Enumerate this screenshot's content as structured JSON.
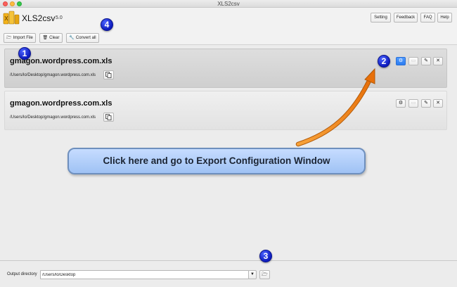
{
  "window": {
    "title": "XLS2csv"
  },
  "app": {
    "name": "XLS2csv",
    "version": "5.0"
  },
  "header_buttons": {
    "setting": "Setting",
    "feedback": "Feedback",
    "faq": "FAQ",
    "help": "Help"
  },
  "toolbar": {
    "import_label": "Import File",
    "clear_label": "Clear",
    "convert_label": "Convert all"
  },
  "files": [
    {
      "name": "gmagon.wordpress.com.xls",
      "path": "/Users/lo/Desktop/gmagon.wordpress.com.xls",
      "selected": true
    },
    {
      "name": "gmagon.wordpress.com.xls",
      "path": "/Users/lo/Desktop/gmagon.wordpress.com.xls",
      "selected": false
    }
  ],
  "icons": {
    "import": "folder-open-icon",
    "clear": "trash-icon",
    "convert": "wrench-icon",
    "copy": "copy-icon",
    "settings": "gear-icon",
    "edit": "pencil-icon",
    "remove": "close-icon",
    "dropdown": "chevron-down-icon",
    "browse": "folder-open-icon"
  },
  "output": {
    "label": "Output directory",
    "value": "/Users/lo/Desktop"
  },
  "annotations": {
    "badge_1": "1",
    "badge_2": "2",
    "badge_3": "3",
    "badge_4": "4",
    "callout": "Click here and go to Export Configuration Window"
  },
  "colors": {
    "badge": "#1425d6",
    "arrow": "#f08a1c",
    "callout": "#b3d0fb",
    "active_button": "#3a86f6"
  }
}
